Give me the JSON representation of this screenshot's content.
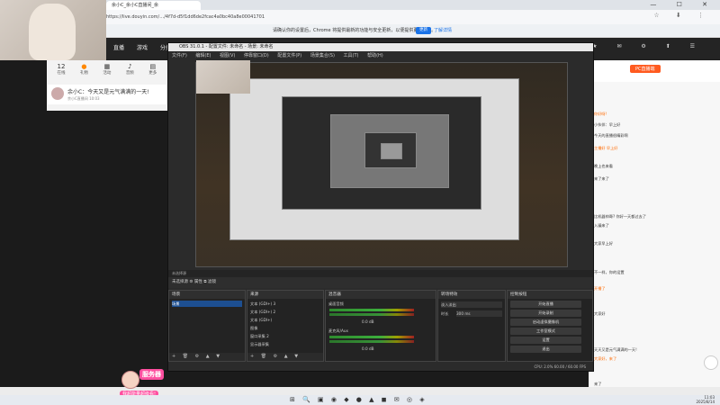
{
  "browser": {
    "tab_title": "余小C_余小C直播间_余",
    "url": "https://live.douyin.com/…/4f7d-d5f1dd6de2fcac4a0bc40a8e00041701",
    "win_controls": "— ☐ ✕",
    "toolbar_icons": "☆ ⬇ ⋮"
  },
  "infobar": {
    "message": "请确认你的设置后，Chrome 将提供最新的功能与安全更新，以便提供更佳服务。",
    "button": "更新",
    "link": "了解详情"
  },
  "site_nav": {
    "items": [
      "直播",
      "游戏",
      "分类",
      "全部",
      "关注"
    ],
    "right_icons": "★ ✉ ⚙ ⬆ ☰"
  },
  "left_panel": {
    "stats": [
      {
        "value": "12",
        "label": "在线"
      },
      {
        "value": "●",
        "label": "礼物"
      },
      {
        "value": "▦",
        "label": "活动"
      },
      {
        "value": "♪",
        "label": "音频"
      },
      {
        "value": "▤",
        "label": "更多"
      }
    ],
    "channel_title": "余小C：今天又是元气满满的一天!",
    "channel_sub": "余小C直播间   10:03"
  },
  "right_panel": {
    "pc_button": "PC直播端",
    "chat": [
      {
        "text": "你好呀!",
        "orange": true
      },
      {
        "text": "小伙伴：早上好",
        "orange": false
      },
      {
        "text": "今天的直播很精彩啊",
        "orange": false
      },
      {
        "text": "主播好 早上好",
        "orange": true
      },
      {
        "text": "晚上也来看",
        "orange": false
      },
      {
        "text": "来了来了",
        "orange": false
      },
      {
        "text": "比机器帅哥? 你好一天都过去了",
        "orange": false
      },
      {
        "text": "入骗来了",
        "orange": false
      },
      {
        "text": "大家早上好",
        "orange": false
      },
      {
        "text": "不一样，你的设置",
        "orange": false
      },
      {
        "text": "开播了",
        "orange": true
      },
      {
        "text": "大家好",
        "orange": false
      },
      {
        "text": "天天又是元气满满的一天!",
        "orange": false
      },
      {
        "text": "大家好，来了",
        "orange": true
      },
      {
        "text": "来了",
        "orange": false
      }
    ]
  },
  "obs": {
    "title": "OBS 31.0.1 - 配置文件: 未命名 - 场景: 未命名",
    "menu": [
      "文件(F)",
      "编辑(E)",
      "视图(V)",
      "停靠窗口(D)",
      "配置文件(P)",
      "场景集合(S)",
      "工具(T)",
      "帮助(H)"
    ],
    "preview_status": "未选择源",
    "source_bar": "未选择源     ⚙ 属性     ⧉ 滤镜",
    "docks": {
      "scenes": {
        "title": "场景",
        "items": [
          "场景"
        ],
        "foot": "+ 🗑 ⚙ ▲ ▼"
      },
      "sources": {
        "title": "来源",
        "items": [
          "文本 (GDI+) 3",
          "文本 (GDI+) 2",
          "文本 (GDI+)",
          "图像",
          "窗口采集 2",
          "显示器采集"
        ],
        "foot": "+ 🗑 ⚙ ▲ ▼"
      },
      "mixer": {
        "title": "混音器",
        "channels": [
          {
            "name": "桌面音频",
            "db": "0.0 dB"
          },
          {
            "name": "麦克风/Aux",
            "db": "0.0 dB"
          }
        ]
      },
      "transitions": {
        "title": "转场特效",
        "type": "淡入淡出",
        "duration_label": "时长",
        "duration": "300 ms"
      },
      "controls": {
        "title": "控制按钮",
        "buttons": [
          "开始直播",
          "开始录制",
          "启动虚拟摄像机",
          "工作室模式",
          "设置",
          "退出"
        ]
      }
    },
    "status": "CPU: 2.0%   60.00 / 60.00 FPS"
  },
  "sticker": {
    "tag": "服务器",
    "caption": "我超能量超级看!"
  },
  "taskbar": {
    "icons": "⊞ 🔍 ▣ ◉ ◆ ● ▲ ◼ ✉ ◎ ◈",
    "time": "11:03",
    "date": "2025/8/14"
  }
}
